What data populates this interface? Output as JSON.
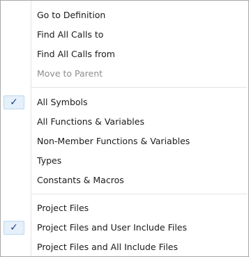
{
  "menu": {
    "group1": [
      {
        "label": "Go to Definition"
      },
      {
        "label": "Find All Calls to"
      },
      {
        "label": "Find All Calls from"
      },
      {
        "label": "Move to Parent",
        "disabled": true
      }
    ],
    "group2": [
      {
        "label": "All Symbols",
        "checked": true
      },
      {
        "label": "All Functions & Variables"
      },
      {
        "label": "Non-Member Functions & Variables"
      },
      {
        "label": "Types"
      },
      {
        "label": "Constants & Macros"
      }
    ],
    "group3": [
      {
        "label": "Project Files"
      },
      {
        "label": "Project Files and User Include Files",
        "checked": true
      },
      {
        "label": "Project Files and All Include Files"
      }
    ],
    "check_glyph": "✓",
    "colors": {
      "check_highlight": "#e6f0fa",
      "check_border": "#b9d7f0",
      "disabled_text": "#8d8d8d"
    }
  }
}
